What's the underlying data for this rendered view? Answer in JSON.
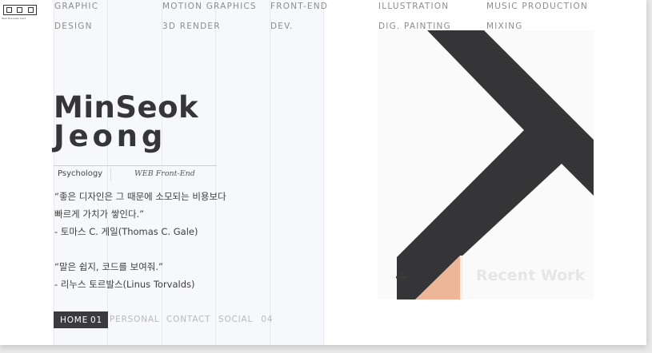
{
  "logo": {
    "text": "Web Business Card"
  },
  "nav_top": [
    {
      "line1": "GRAPHIC",
      "line2": "DESIGN"
    },
    {
      "line1": "MOTION GRAPHICS",
      "line2": "3D RENDER"
    },
    {
      "line1": "FRONT-END",
      "line2": "DEV."
    },
    {
      "line1": "ILLUSTRATION",
      "line2": "DIG. PAINTING"
    },
    {
      "line1": "MUSIC PRODUCTION",
      "line2": "MIXING"
    }
  ],
  "profile": {
    "first_name": "MinSeok",
    "last_name": "Jeong",
    "role_1": "Psychology",
    "role_2": "WEB Front-End"
  },
  "quotes": {
    "q1_line1": "“좋은 디자인은 그 때문에 소모되는 비용보다",
    "q1_line2": "빠르게 가치가 쌓인다.”",
    "q1_author": " -  토마스 C. 게일(Thomas C. Gale)",
    "q2_line1": "“말은 쉽지, 코드를 보여줘.”",
    "q2_author": " -  리누스 토르발스(Linus Torvalds)"
  },
  "bottom_nav": [
    {
      "label": "HOME",
      "num": "01",
      "active": true
    },
    {
      "label": "PERSONAL",
      "num": ""
    },
    {
      "label": "CONTACT",
      "num": ""
    },
    {
      "label": "SOCIAL",
      "num": "04"
    }
  ],
  "artwork": {
    "plus_label": "+",
    "recent_work": "Recent Work",
    "colors": {
      "shape": "#353537",
      "accent": "#ecb697",
      "bg": "#fafafa"
    }
  }
}
